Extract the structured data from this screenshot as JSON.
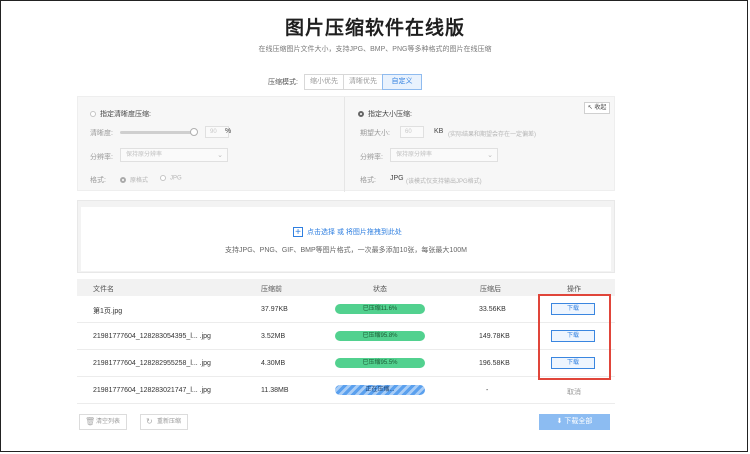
{
  "header": {
    "title": "图片压缩软件在线版",
    "subtitle": "在线压缩图片文件大小，支持JPG、BMP、PNG等多种格式的图片在线压缩"
  },
  "mode": {
    "label": "压缩模式:",
    "tabs": [
      "缩小优先",
      "清晰优先",
      "自定义"
    ],
    "active": "自定义"
  },
  "settings": {
    "collapse_label": "收起",
    "left": {
      "radio_label": "指定清晰度压缩:",
      "clarity_label": "清晰度:",
      "clarity_value": "90",
      "clarity_unit": "%",
      "resolution_label": "分辨率:",
      "resolution_placeholder": "保持原分辨率",
      "format_label": "格式:",
      "format_options": [
        "原格式",
        "JPG"
      ]
    },
    "right": {
      "radio_label": "指定大小压缩:",
      "size_label": "期望大小:",
      "size_value": "60",
      "size_unit": "KB",
      "size_hint": "(实际结果和期望会存在一定偏差)",
      "resolution_label": "分辨率:",
      "resolution_placeholder": "保持原分辨率",
      "format_label": "格式:",
      "format_value": "JPG",
      "format_hint": "(该模式仅支持输出JPG格式)"
    }
  },
  "upload": {
    "link_text": "点击选择 或 将图片拖拽到此处",
    "hint": "支持JPG、PNG、GIF、BMP等图片格式，一次最多添加10张，每张最大100M"
  },
  "table": {
    "headers": [
      "文件名",
      "压缩前",
      "状态",
      "压缩后",
      "操作"
    ],
    "rows": [
      {
        "name": "第1页.jpg",
        "before": "37.97KB",
        "status": "已压缩11.6%",
        "after": "33.56KB",
        "action": "下载"
      },
      {
        "name": "21981777604_128283054395_l... .jpg",
        "before": "3.52MB",
        "status": "已压缩95.8%",
        "after": "149.78KB",
        "action": "下载"
      },
      {
        "name": "21981777604_128282955258_l... .jpg",
        "before": "4.30MB",
        "status": "已压缩95.5%",
        "after": "196.58KB",
        "action": "下载"
      },
      {
        "name": "21981777604_128283021747_l... .jpg",
        "before": "11.38MB",
        "status": "正在压缩...",
        "after": "-",
        "action": "取消"
      }
    ]
  },
  "footer": {
    "clear_label": "清空列表",
    "recompress_label": "重新压缩",
    "download_all_label": "下载全部"
  },
  "colors": {
    "accent": "#2f7fe0",
    "success": "#52d18f",
    "highlight": "#e0453a"
  }
}
